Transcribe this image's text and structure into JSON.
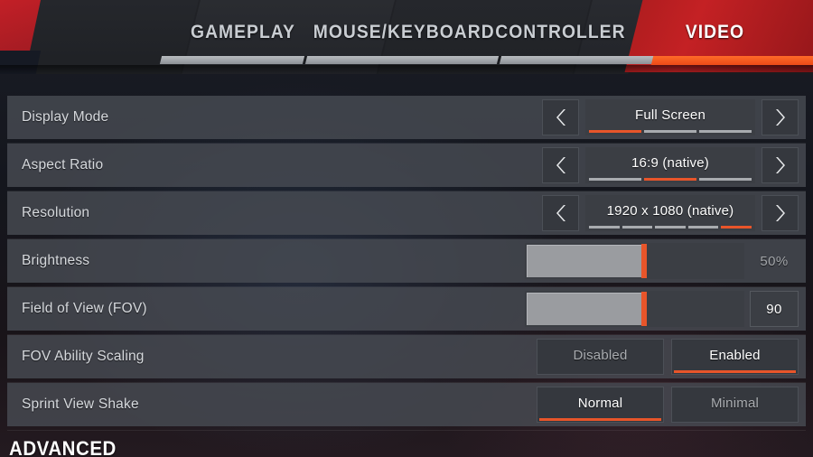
{
  "tabs": [
    {
      "label": "GAMEPLAY",
      "active": false
    },
    {
      "label": "MOUSE/KEYBOARD",
      "active": false
    },
    {
      "label": "CONTROLLER",
      "active": false
    },
    {
      "label": "VIDEO",
      "active": true
    }
  ],
  "settings": [
    {
      "label": "Display Mode",
      "type": "stepper",
      "value": "Full Screen",
      "segments": 3,
      "active_segment": 1
    },
    {
      "label": "Aspect Ratio",
      "type": "stepper",
      "value": "16:9 (native)",
      "segments": 3,
      "active_segment": 2
    },
    {
      "label": "Resolution",
      "type": "stepper",
      "value": "1920 x 1080 (native)",
      "segments": 5,
      "active_segment": 5
    },
    {
      "label": "Brightness",
      "type": "slider",
      "value": "50%",
      "percent": 50,
      "boxed_readout": false
    },
    {
      "label": "Field of View (FOV)",
      "type": "slider",
      "value": "90",
      "percent": 50,
      "boxed_readout": true
    },
    {
      "label": "FOV Ability Scaling",
      "type": "toggle",
      "options": [
        {
          "label": "Disabled",
          "selected": false
        },
        {
          "label": "Enabled",
          "selected": true
        }
      ]
    },
    {
      "label": "Sprint View Shake",
      "type": "toggle",
      "options": [
        {
          "label": "Normal",
          "selected": true
        },
        {
          "label": "Minimal",
          "selected": false
        }
      ]
    }
  ],
  "section_heading": "ADVANCED",
  "icons": {
    "prev": "chevron-left-icon",
    "next": "chevron-right-icon"
  },
  "colors": {
    "accent_orange": "#e8552a",
    "accent_red": "#c42124",
    "panel": "#484c54",
    "control": "#3b3e44"
  }
}
